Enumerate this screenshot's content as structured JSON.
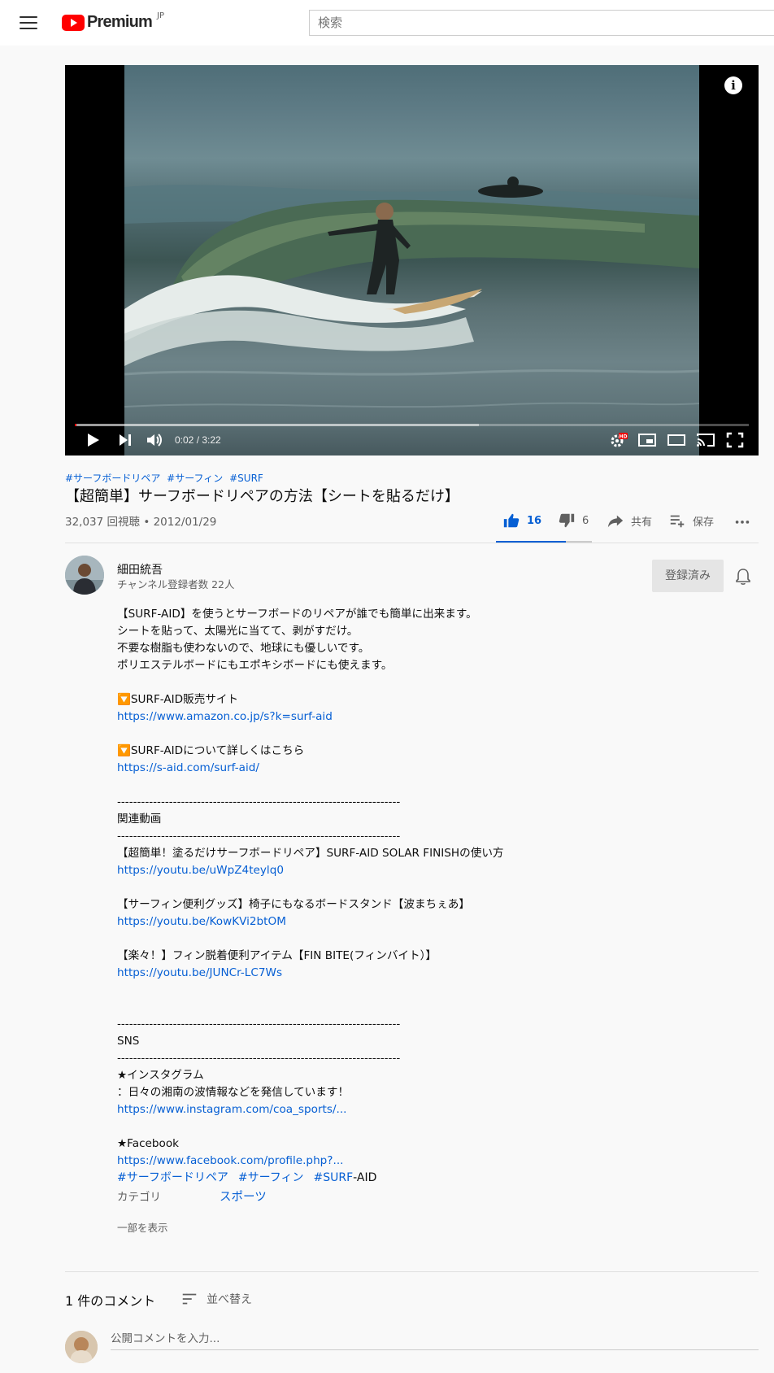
{
  "masthead": {
    "logo_text": "Premium",
    "logo_region": "JP",
    "search_placeholder": "検索"
  },
  "player": {
    "time": "0:02 / 3:22",
    "progress_played_fraction": 0.002,
    "progress_loaded_fraction": 0.6,
    "info_glyph": "i",
    "hd_badge": "HD"
  },
  "video": {
    "hashtags": [
      "#サーフボードリペア",
      "#サーフィン",
      "#SURF"
    ],
    "title": "【超簡単】サーフボードリペアの方法【シートを貼るだけ】",
    "meta": "32,037 回視聴 • 2012/01/29",
    "likes": "16",
    "dislikes": "6",
    "like_fraction": 0.73,
    "share_label": "共有",
    "save_label": "保存"
  },
  "channel": {
    "name": "細田統吾",
    "subscribers": "チャンネル登録者数 22人",
    "subscribe_label": "登録済み"
  },
  "description": {
    "lines": [
      "【SURF-AID】を使うとサーフボードのリペアが誰でも簡単に出来ます。",
      "シートを貼って、太陽光に当てて、剥がすだけ。",
      "不要な樹脂も使わないので、地球にも優しいです。",
      "ポリエステルボードにもエポキシボードにも使えます。",
      "",
      "🔽SURF-AID販売サイト",
      "https://www.amazon.co.jp/s?k=surf-aid",
      "",
      "🔽SURF-AIDについて詳しくはこちら",
      "https://s-aid.com/surf-aid/",
      "",
      "-----------------------------------------------------------------------",
      "関連動画",
      "-----------------------------------------------------------------------",
      "【超簡単！塗るだけサーフボードリペア】SURF-AID SOLAR FINISHの使い方",
      "https://youtu.be/uWpZ4teylq0",
      "",
      "【サーフィン便利グッズ】椅子にもなるボードスタンド【波まちぇあ】",
      "https://youtu.be/KowKVi2btOM",
      "",
      "【楽々！】フィン脱着便利アイテム【FIN BITE(フィンバイト）】",
      "https://youtu.be/JUNCr-LC7Ws",
      "",
      "",
      "-----------------------------------------------------------------------",
      "SNS",
      "-----------------------------------------------------------------------",
      "★インスタグラム",
      "：日々の湘南の波情報などを発信しています！",
      "https://www.instagram.com/coa_sports/...",
      "",
      "★Facebook",
      "https://www.facebook.com/profile.php?..."
    ],
    "tags": [
      "#サーフボードリペア",
      "#サーフィン",
      "#SURF"
    ],
    "tag_suffix": "-AID",
    "category_label": "カテゴリ",
    "category_value": "スポーツ",
    "show_less": "一部を表示"
  },
  "comments": {
    "count_label": "1 件のコメント",
    "sort_label": "並べ替え",
    "input_placeholder": "公開コメントを入力..."
  },
  "colors": {
    "link": "#065fd4",
    "brand_red": "#ff0000",
    "subscribed_bg": "#e5e5e5"
  }
}
